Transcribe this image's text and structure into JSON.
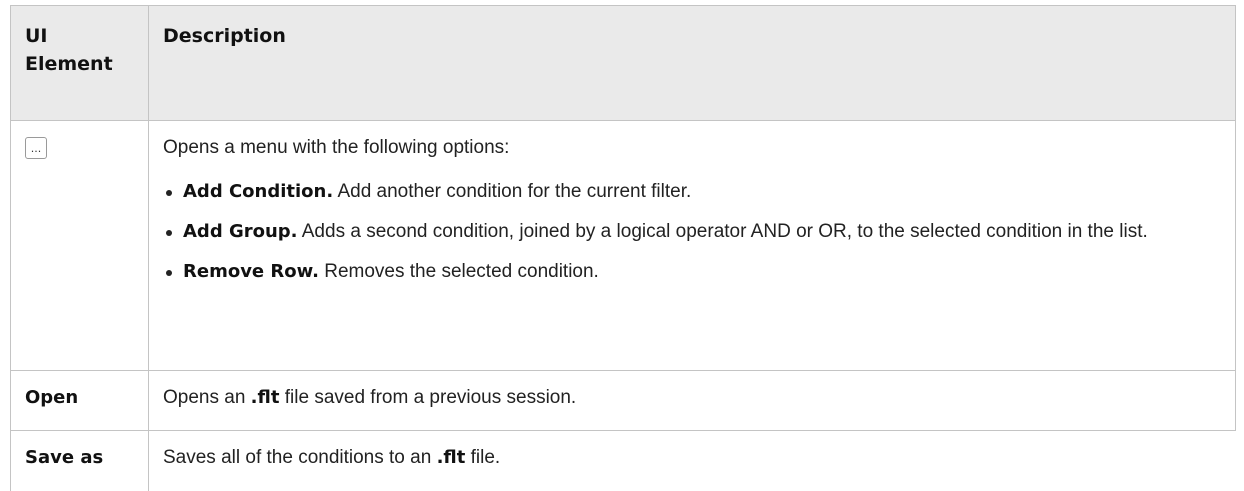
{
  "table": {
    "headers": {
      "ui_element_line1": "UI",
      "ui_element_line2": "Element",
      "description": "Description"
    },
    "rows": [
      {
        "element_icon": "ellipsis-icon",
        "element_icon_text": "...",
        "intro": "Opens a menu with the following options:",
        "options": [
          {
            "term": "Add Condition.",
            "text": " Add another condition for the current filter."
          },
          {
            "term": "Add Group.",
            "text": " Adds a second condition, joined by a logical operator AND or OR, to the selected condition in the list."
          },
          {
            "term": "Remove Row.",
            "text": " Removes the selected condition."
          }
        ]
      },
      {
        "element": "Open",
        "desc_before": "Opens an ",
        "desc_ext": ".flt",
        "desc_after": " file saved from a previous session."
      },
      {
        "element": "Save as",
        "desc_before": "Saves all of the conditions to an ",
        "desc_ext": ".flt",
        "desc_after": " file."
      }
    ]
  },
  "colors": {
    "header_bg": "#eaeaea",
    "border": "#c4c4c4",
    "text": "#222222"
  }
}
